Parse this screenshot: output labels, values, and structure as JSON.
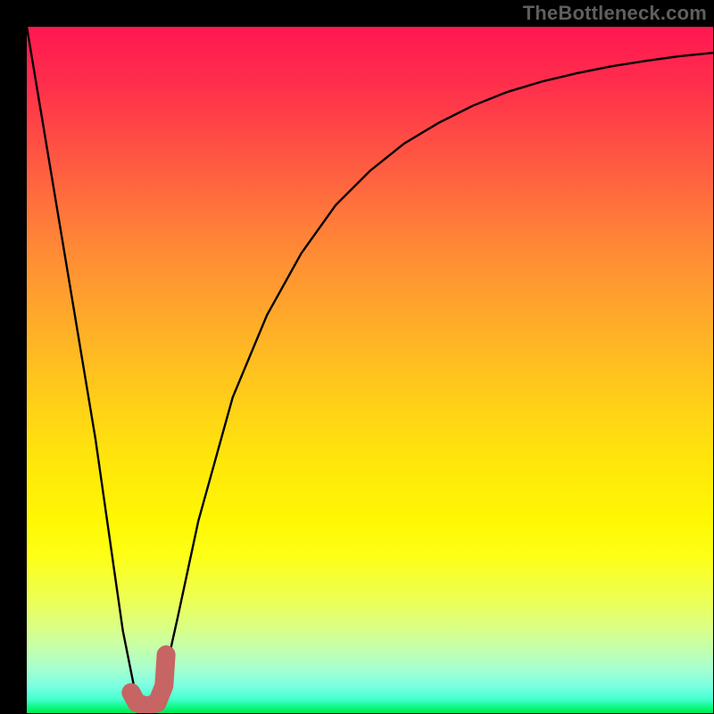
{
  "watermark": "TheBottleneck.com",
  "chart_data": {
    "type": "line",
    "title": "",
    "xlabel": "",
    "ylabel": "",
    "xlim": [
      0,
      100
    ],
    "ylim": [
      0,
      100
    ],
    "grid": false,
    "series": [
      {
        "name": "bottleneck-curve",
        "x": [
          0,
          5,
          10,
          14,
          16,
          17,
          18.5,
          20,
          22,
          25,
          30,
          35,
          40,
          45,
          50,
          55,
          60,
          65,
          70,
          75,
          80,
          85,
          90,
          95,
          100
        ],
        "values": [
          100,
          70,
          40,
          12,
          2,
          0,
          1,
          5,
          14,
          28,
          46,
          58,
          67,
          74,
          79,
          83,
          86,
          88.5,
          90.5,
          92,
          93.2,
          94.2,
          95,
          95.7,
          96.2
        ]
      }
    ],
    "highlight_marker": {
      "name": "optimal-point-J",
      "x": [
        15.2,
        16.0,
        17.5,
        19.0,
        20.0,
        20.3
      ],
      "values": [
        3.0,
        1.5,
        1.0,
        1.5,
        4.0,
        8.5
      ]
    },
    "background": {
      "type": "vertical-gradient",
      "stops": [
        {
          "pos": 0.0,
          "color": "#ff1851"
        },
        {
          "pos": 0.5,
          "color": "#ffd316"
        },
        {
          "pos": 0.78,
          "color": "#fbff20"
        },
        {
          "pos": 1.0,
          "color": "#00e74f"
        }
      ]
    }
  }
}
